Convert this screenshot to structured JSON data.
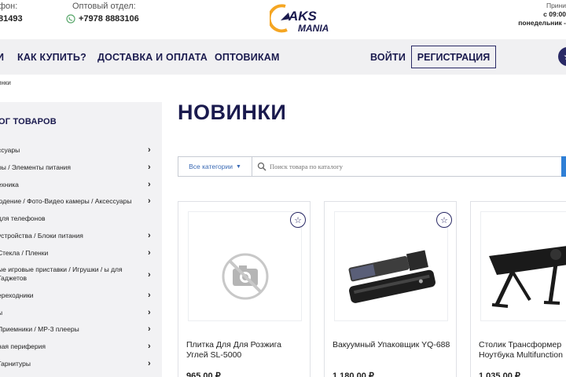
{
  "header": {
    "phone_label": "фон:",
    "phone_value": "81493",
    "wholesale_label": "Оптовый отдел:",
    "wholesale_phone": "+7978 8883106",
    "hours_accept": "Прини",
    "hours_time": "с 09:00",
    "hours_days": "понедельник -"
  },
  "logo": {
    "text_top": "AKS",
    "text_bottom": "MANIA"
  },
  "nav": {
    "items": [
      "И",
      "КАК КУПИТЬ?",
      "ДОСТАВКА И ОПЛАТА",
      "ОПТОВИКАМ"
    ],
    "login": "ВОЙТИ",
    "register": "РЕГИСТРАЦИЯ"
  },
  "breadcrumb": "инки",
  "sidebar": {
    "title": "ОГ ТОВАРОВ",
    "categories": [
      {
        "label": "ссуары",
        "arrow": true
      },
      {
        "label": "ры / Элементы питания",
        "arrow": true
      },
      {
        "label": "ехника",
        "arrow": true
      },
      {
        "label": "юдение / Фото-Видео камеры / Аксессуары",
        "arrow": true
      },
      {
        "label": "для телефонов",
        "arrow": false
      },
      {
        "label": "устройства / Блоки питания",
        "arrow": true
      },
      {
        "label": "Стекла / Пленки",
        "arrow": true
      },
      {
        "label": "ые игровые приставки / Игрушки / ы для Гаджетов",
        "arrow": true
      },
      {
        "label": "ереходники",
        "arrow": true
      },
      {
        "label": "ы",
        "arrow": true
      },
      {
        "label": "Приемники / MP-3 плееры",
        "arrow": true
      },
      {
        "label": "ная периферия",
        "arrow": true
      },
      {
        "label": "Гарнитуры",
        "arrow": true
      }
    ]
  },
  "main": {
    "title": "НОВИНКИ",
    "search": {
      "category": "Все категории",
      "placeholder": "Поиск товара по каталогу"
    },
    "products": [
      {
        "name": "Плитка Для Для Розжига Углей SL-5000",
        "price": "965,00 ₽",
        "image": "no-photo-icon",
        "favorite": true
      },
      {
        "name": "Вакуумный Упаковщик YQ-688",
        "price": "1 180,00 ₽",
        "image": "vacuum-sealer-photo",
        "favorite": true
      },
      {
        "name": "Столик Трансформер Ноутбука Multifunction",
        "price": "1 035,00 ₽",
        "image": "laptop-table-photo",
        "favorite": false
      }
    ]
  },
  "colors": {
    "navy": "#1a1a4e",
    "nav_bg": "#f0f0f2",
    "sidebar_bg": "#f2f2f4",
    "accent_blue": "#2f7fd6",
    "logo_orange": "#f5a623"
  }
}
